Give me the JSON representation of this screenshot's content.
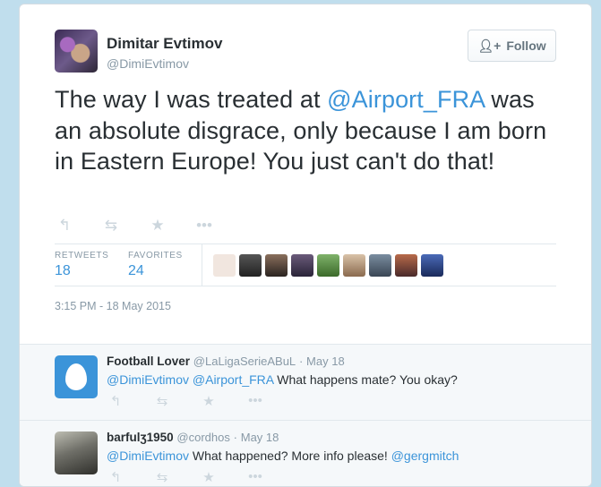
{
  "tweet": {
    "author": {
      "name": "Dimitar Evtimov",
      "handle": "@DimiEvtimov"
    },
    "follow_label": "Follow",
    "text_before": "The way I was treated at ",
    "mention": "@Airport_FRA",
    "text_after": " was an absolute disgrace, only because I am born in Eastern Europe! You just can't do that!",
    "actions": {
      "reply_icon": "reply-icon",
      "retweet_icon": "retweet-icon",
      "favorite_icon": "star-icon",
      "more_icon": "ellipsis-icon"
    },
    "stats": {
      "retweets_label": "RETWEETS",
      "retweets_value": "18",
      "favorites_label": "FAVORITES",
      "favorites_value": "24"
    },
    "timestamp": "3:15 PM - 18 May 2015"
  },
  "replies": [
    {
      "name": "Football Lover",
      "handle": "@LaLigaSerieABuL",
      "sep": "·",
      "date": "May 18",
      "mention1": "@DimiEvtimov",
      "mention2": "@Airport_FRA",
      "text": "What happens mate? You okay?"
    },
    {
      "name": "barfulʒ1950",
      "handle": "@cordhos",
      "sep": "·",
      "date": "May 18",
      "mention1": "@DimiEvtimov",
      "text": "What happened? More info please!",
      "mention2": "@gergmitch"
    }
  ],
  "colors": {
    "background": "#c0deed",
    "link": "#3b94d9",
    "text": "#292f33",
    "muted": "#8899a6"
  }
}
